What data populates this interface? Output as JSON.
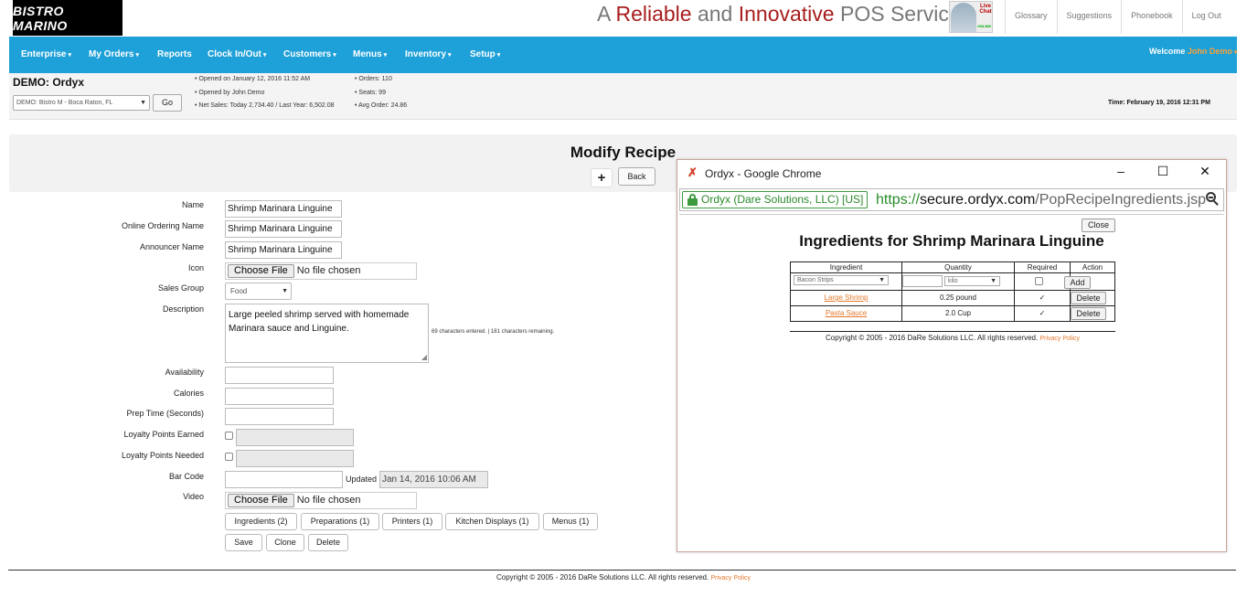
{
  "brand": {
    "logo_text": "BISTRO MARINO"
  },
  "tagline": {
    "part1": "A ",
    "part2": "Reliable",
    "part3": " and ",
    "part4": "Innovative",
    "part5": " POS Service"
  },
  "livechat": {
    "line1": "Live",
    "line2": "Chat",
    "status": "ONLINE"
  },
  "top_links": [
    "Glossary",
    "Suggestions",
    "Phonebook",
    "Log Out"
  ],
  "nav": {
    "items": [
      {
        "label": "Enterprise"
      },
      {
        "label": "My Orders"
      },
      {
        "label": "Reports"
      },
      {
        "label": "Clock In/Out"
      },
      {
        "label": "Customers"
      },
      {
        "label": "Menus"
      },
      {
        "label": "Inventory"
      },
      {
        "label": "Setup"
      }
    ],
    "welcome_prefix": "Welcome",
    "user": "John Demo"
  },
  "info": {
    "title": "DEMO: Ordyx",
    "location": "DEMO: Bistro M - Boca Raton, FL",
    "go_label": "Go",
    "opened_on": "• Opened on January 12, 2016 11:52 AM",
    "opened_by": "• Opened by John Demo",
    "net_sales": "• Net Sales:  Today 2,734.40 / Last Year: 6,502.08",
    "orders": "• Orders: 110",
    "seats": "• Seats: 99",
    "avg_order": "• Avg Order: 24.86",
    "time": "Time: February 19, 2016 12:31 PM"
  },
  "page": {
    "title": "Modify Recipe",
    "plus_label": "+",
    "back_label": "Back"
  },
  "form": {
    "name_label": "Name",
    "name_value": "Shrimp Marinara Linguine",
    "online_label": "Online Ordering Name",
    "online_value": "Shrimp Marinara Linguine",
    "announcer_label": "Announcer Name",
    "announcer_value": "Shrimp Marinara Linguine",
    "icon_label": "Icon",
    "choose_file": "Choose File",
    "no_file": "No file chosen",
    "sales_group_label": "Sales Group",
    "sales_group_value": "Food",
    "description_label": "Description",
    "description_value": "Large peeled shrimp served with homemade Marinara sauce and Linguine.",
    "char_count": "69 characters entered. | 181 characters remaining.",
    "availability_label": "Availability",
    "calories_label": "Calories",
    "prep_label": "Prep Time (Seconds)",
    "loyalty_earned_label": "Loyalty Points Earned",
    "loyalty_needed_label": "Loyalty Points Needed",
    "barcode_label": "Bar Code",
    "updated_label": "Updated",
    "updated_value": "Jan 14, 2016 10:06 AM",
    "video_label": "Video"
  },
  "tab_buttons": [
    "Ingredients (2)",
    "Preparations (1)",
    "Printers (1)",
    "Kitchen Displays (1)",
    "Menus (1)"
  ],
  "actions": {
    "save": "Save",
    "clone": "Clone",
    "delete": "Delete"
  },
  "footer": {
    "text": "Copyright © 2005 - 2016 DaRe Solutions LLC. All rights reserved.",
    "privacy": "Privacy Policy"
  },
  "popup": {
    "title": "Ordyx - Google Chrome",
    "secure_label": "Ordyx (Dare Solutions, LLC) [US]",
    "url_scheme": "https://",
    "url_host": "secure.ordyx.com",
    "url_path": "/PopRecipeIngredients.jsp",
    "close_label": "Close",
    "heading": "Ingredients for Shrimp Marinara Linguine",
    "columns": [
      "Ingredient",
      "Quantity",
      "Required",
      "Action"
    ],
    "new_row": {
      "ingredient": "Bacon Strips",
      "unit": "kilo",
      "add_label": "Add"
    },
    "rows": [
      {
        "ingredient": "Large Shrimp",
        "quantity": "0.25 pound",
        "required": "✓",
        "action": "Delete"
      },
      {
        "ingredient": "Pasta Sauce",
        "quantity": "2.0 Cup",
        "required": "✓",
        "action": "Delete"
      }
    ],
    "footer_text": "Copyright © 2005 - 2016 DaRe Solutions LLC. All rights reserved.",
    "privacy": "Privacy Policy"
  },
  "colors": {
    "nav_bg": "#1ea0d8",
    "accent_orange": "#e4782c",
    "brand_red": "#a81d1d",
    "secure_green": "#2a8a2a"
  }
}
